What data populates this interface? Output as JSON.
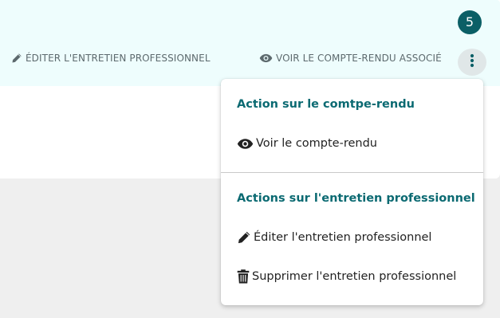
{
  "card": {
    "badge_count": "5",
    "edit_link_label": "ÉDITER L'ENTRETIEN PROFESSIONNEL",
    "view_link_label": "VOIR LE COMPTE-RENDU ASSOCIÉ"
  },
  "menu": {
    "section_report": {
      "heading": "Action sur le comtpe-rendu",
      "items": [
        {
          "label": "Voir le compte-rendu",
          "icon": "eye-icon"
        }
      ]
    },
    "section_interview": {
      "heading": "Actions sur l'entretien professionnel",
      "items": [
        {
          "label": "Éditer l'entretien professionnel",
          "icon": "pencil-icon"
        },
        {
          "label": "Supprimer l'entretien professionnel",
          "icon": "trash-icon"
        }
      ]
    }
  },
  "colors": {
    "accent": "#0b6a72",
    "badge_bg": "#0b5f66",
    "header_bg": "#eefdfd",
    "page_bg": "#efefef",
    "link_text": "#5d6a6e"
  },
  "icons": {
    "edit_link": "pencil-icon",
    "view_link": "eye-icon",
    "more_button": "more-vertical-icon"
  }
}
